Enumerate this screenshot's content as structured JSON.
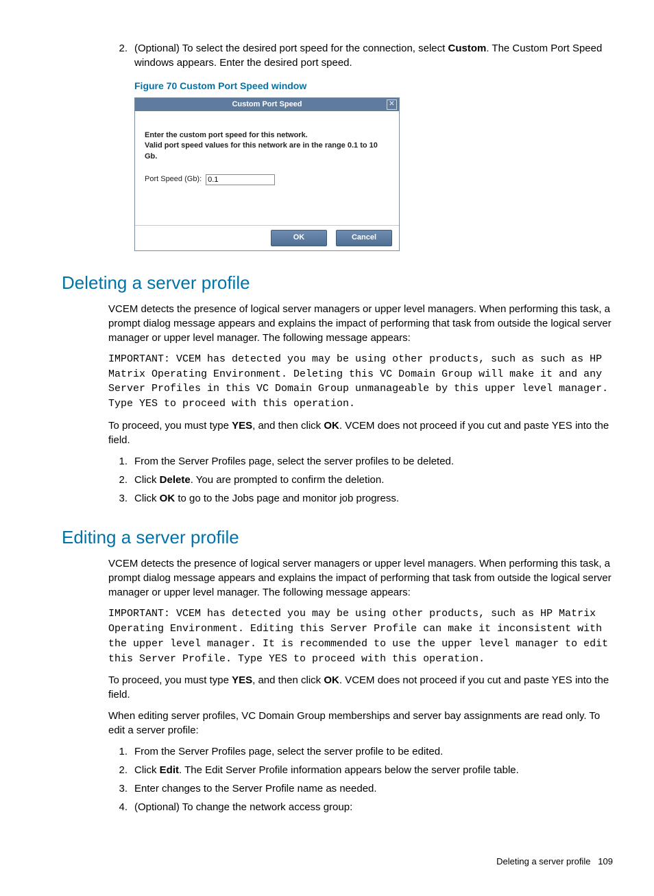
{
  "topList": {
    "item2": {
      "num": "2.",
      "text_before": "(Optional) To select the desired port speed for the connection, select ",
      "bold1": "Custom",
      "text_after": ". The Custom Port Speed windows appears. Enter the desired port speed."
    }
  },
  "figure": {
    "caption": "Figure 70 Custom Port Speed window",
    "title": "Custom Port Speed",
    "close": "✕",
    "instr1": "Enter the custom port speed for this network.",
    "instr2": "Valid port speed values for this network are in the range 0.1 to 10 Gb.",
    "fieldLabel": "Port Speed (Gb):",
    "fieldValue": "0.1",
    "ok": "OK",
    "cancel": "Cancel"
  },
  "s1": {
    "heading": "Deleting a server profile",
    "p1": "VCEM detects the presence of logical server managers or upper level managers. When performing this task, a prompt dialog message appears and explains the impact of performing that task from outside the logical server manager or upper level manager. The following message appears:",
    "mono": "IMPORTANT: VCEM has detected you may be using other products, such as such as HP Matrix Operating Environment. Deleting this VC Domain Group will make it and any Server Profiles in this VC Domain Group unmanageable by this upper level manager. Type YES to proceed with this operation.",
    "p2_a": "To proceed, you must type ",
    "p2_b1": "YES",
    "p2_b": ", and then click ",
    "p2_b2": "OK",
    "p2_c": ". VCEM does not proceed if you cut and paste YES into the field.",
    "steps": [
      {
        "n": "1.",
        "t": "From the Server Profiles page, select the server profiles to be deleted."
      },
      {
        "n": "2.",
        "t_before": "Click ",
        "bold": "Delete",
        "t_after": ". You are prompted to confirm the deletion."
      },
      {
        "n": "3.",
        "t_before": "Click ",
        "bold": "OK",
        "t_after": " to go to the Jobs page and monitor job progress."
      }
    ]
  },
  "s2": {
    "heading": "Editing a server profile",
    "p1": "VCEM detects the presence of logical server managers or upper level managers. When performing this task, a prompt dialog message appears and explains the impact of performing that task from outside the logical server manager or upper level manager. The following message appears:",
    "mono": "IMPORTANT: VCEM has detected you may be using other products, such as HP Matrix Operating Environment. Editing this Server Profile can make it inconsistent with the upper level manager. It is recommended to use the upper level manager to edit this Server Profile. Type YES to proceed with this operation.",
    "p2_a": "To proceed, you must type ",
    "p2_b1": "YES",
    "p2_b": ", and then click ",
    "p2_b2": "OK",
    "p2_c": ". VCEM does not proceed if you cut and paste YES into the field.",
    "p3": "When editing server profiles, VC Domain Group memberships and server bay assignments are read only. To edit a server profile:",
    "steps": [
      {
        "n": "1.",
        "t": "From the Server Profiles page, select the server profile to be edited."
      },
      {
        "n": "2.",
        "t_before": "Click ",
        "bold": "Edit",
        "t_after": ". The Edit Server Profile information appears below the server profile table."
      },
      {
        "n": "3.",
        "t": "Enter changes to the Server Profile name as needed."
      },
      {
        "n": "4.",
        "t": "(Optional) To change the network access group:"
      }
    ]
  },
  "footer": {
    "text": "Deleting a server profile",
    "page": "109"
  }
}
